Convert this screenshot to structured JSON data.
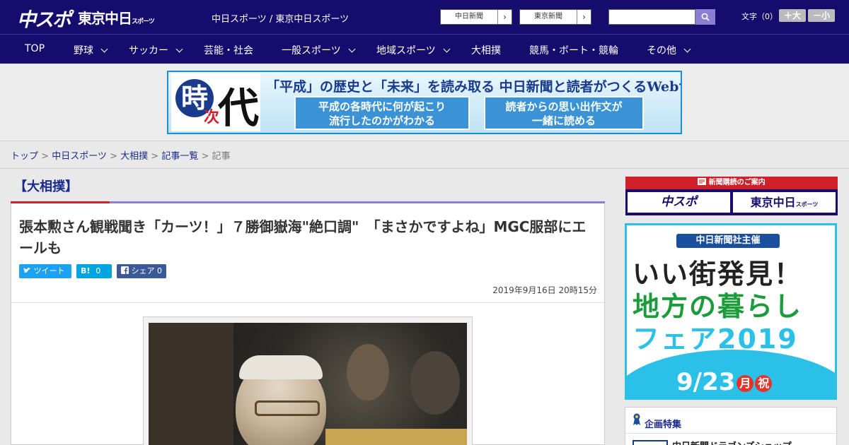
{
  "header": {
    "logo_chuspo": "中スポ",
    "logo_tokyo": "東京中日",
    "logo_tokyo_small": "スポーツ",
    "site_links": "中日スポーツ / 東京中日スポーツ",
    "paper_links": [
      {
        "label": "中日新聞",
        "arrow": "›"
      },
      {
        "label": "東京新聞",
        "arrow": "›"
      }
    ],
    "search_placeholder": "",
    "font_size_label": "文字（0）",
    "font_larger": "＋大",
    "font_smaller": "－小"
  },
  "nav": {
    "items": [
      {
        "label": "TOP",
        "has_menu": false
      },
      {
        "label": "野球",
        "has_menu": true
      },
      {
        "label": "サッカー",
        "has_menu": true
      },
      {
        "label": "芸能・社会",
        "has_menu": false
      },
      {
        "label": "一般スポーツ",
        "has_menu": true
      },
      {
        "label": "地域スポーツ",
        "has_menu": true
      },
      {
        "label": "大相撲",
        "has_menu": false
      },
      {
        "label": "競馬・ボート・競輪",
        "has_menu": false
      },
      {
        "label": "その他",
        "has_menu": true
      }
    ]
  },
  "banner": {
    "char1": "時",
    "char2": "次",
    "char3": "代",
    "headline": "「平成」の歴史と「未来」を読み取る 中日新聞と読者がつくるWebサイト",
    "box1_line1": "平成の各時代に何が起こり",
    "box1_line2": "流行したのかがわかる",
    "box2_line1": "読者からの思い出作文が",
    "box2_line2": "一緒に読める"
  },
  "breadcrumb": {
    "items": [
      "トップ",
      "中日スポーツ",
      "大相撲",
      "記事一覧"
    ],
    "current": "記事",
    "separator": ">"
  },
  "article": {
    "category": "【大相撲】",
    "title": "張本勲さん観戦聞き「カーツ！」７勝御嶽海\"絶口調\"　「まさかですよね」MGC服部にエールも",
    "share": {
      "tweet": "ツイート",
      "hatena": "B!",
      "hatena_count": "0",
      "facebook": "シェア",
      "facebook_count": "0"
    },
    "date": "2019年9月16日 20時15分"
  },
  "sidebar": {
    "subscribe_header": "新聞購読のご案内",
    "subscribe_chuspo": "中スポ",
    "subscribe_tokyo": "東京中日",
    "subscribe_tokyo_small": "スポーツ",
    "fair_tag": "中日新聞社主催",
    "fair_line1": "いい街発見！",
    "fair_line2": "地方の暮らし",
    "fair_line3": "フェア2019",
    "fair_date": "9/23",
    "fair_month_kanji": "月",
    "fair_holiday": "祝",
    "special_label": "企画特集",
    "special_item": "中日新聞ドラゴンズショップ"
  },
  "colors": {
    "header_bg": "#160c6e",
    "accent_red": "#d0202a",
    "accent_purple": "#8a7fd0",
    "link_blue": "#1a2a8c",
    "twitter": "#1da1f2",
    "hatena": "#00a4de",
    "facebook": "#3b5998",
    "fair_cyan": "#2bc0e8"
  }
}
